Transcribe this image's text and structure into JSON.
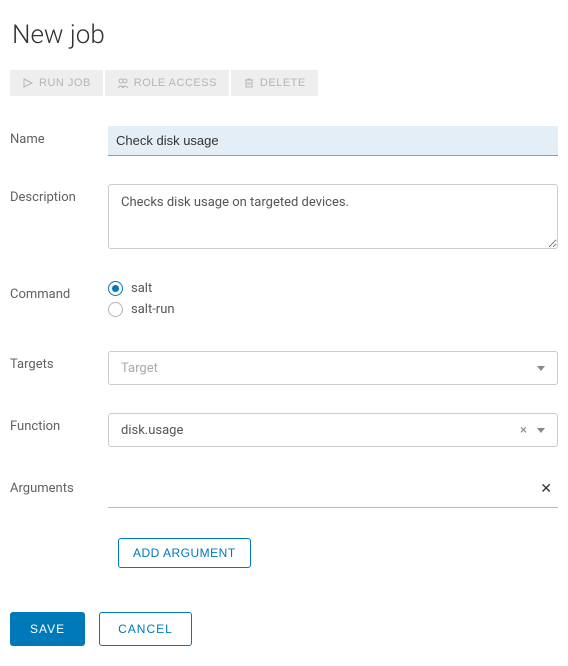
{
  "title": "New job",
  "toolbar": {
    "run_job": "RUN JOB",
    "role_access": "ROLE ACCESS",
    "delete": "DELETE"
  },
  "labels": {
    "name": "Name",
    "description": "Description",
    "command": "Command",
    "targets": "Targets",
    "function": "Function",
    "arguments": "Arguments"
  },
  "fields": {
    "name_value": "Check disk usage",
    "description_value": "Checks disk usage on targeted devices.",
    "command_options": {
      "salt": "salt",
      "salt_run": "salt-run"
    },
    "command_selected": "salt",
    "targets_placeholder": "Target",
    "targets_value": "",
    "function_value": "disk.usage"
  },
  "buttons": {
    "add_argument": "ADD ARGUMENT",
    "save": "SAVE",
    "cancel": "CANCEL"
  }
}
